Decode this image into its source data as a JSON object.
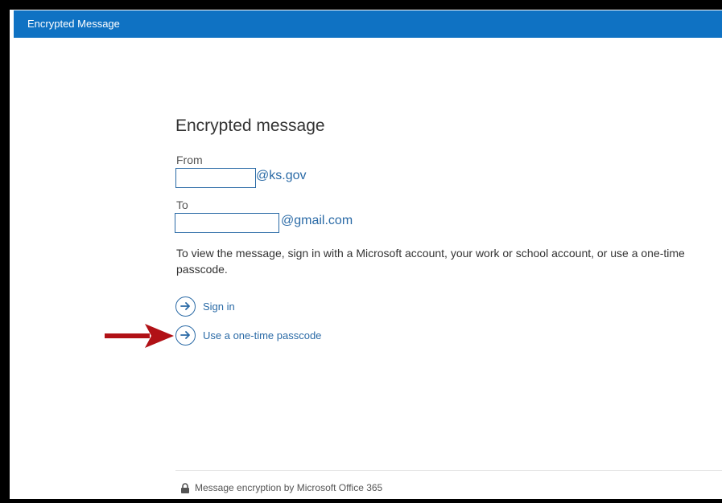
{
  "window": {
    "title": "Encrypted Message",
    "accent_color": "#0f72c3"
  },
  "message": {
    "heading": "Encrypted message",
    "from_label": "From",
    "from_domain": "@ks.gov",
    "to_label": "To",
    "to_domain": "@gmail.com",
    "instructions": "To view the message, sign in with a Microsoft account, your work or school account, or use a one-time passcode."
  },
  "options": [
    {
      "label": "Sign in",
      "icon": "arrow-circle-icon"
    },
    {
      "label": "Use a one-time passcode",
      "icon": "arrow-circle-icon"
    }
  ],
  "annotation": {
    "icon": "red-arrow-icon",
    "color": "#b11116"
  },
  "footer": {
    "icon": "lock-icon",
    "text": "Message encryption by Microsoft Office 365"
  }
}
